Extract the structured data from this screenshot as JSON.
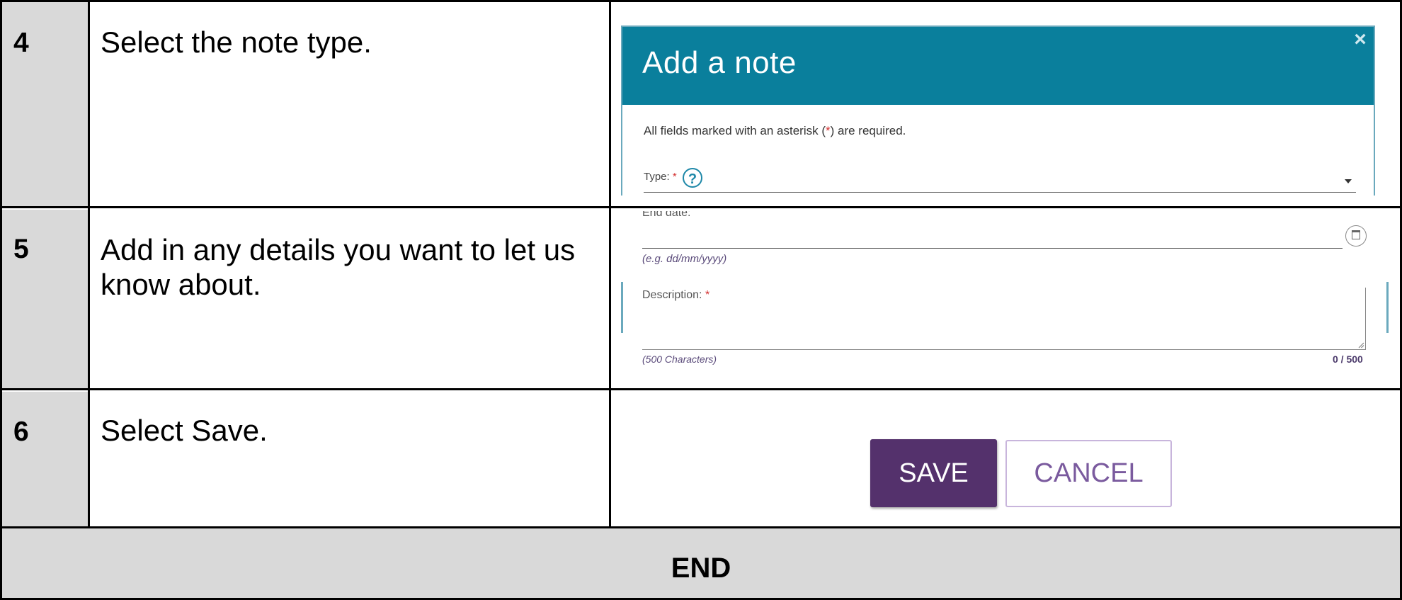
{
  "rows": [
    {
      "number": "4",
      "instruction": "Select the note type."
    },
    {
      "number": "5",
      "instruction": "Add in any details you want to let us know about."
    },
    {
      "number": "6",
      "instruction": "Select Save."
    }
  ],
  "end_label": "END",
  "add_note_dialog": {
    "title": "Add a note",
    "close_glyph": "×",
    "required_note_pre": "All fields marked with an asterisk (",
    "required_note_asterisk": "*",
    "required_note_post": ") are required.",
    "type_label": "Type:",
    "required_marker": "*",
    "help_glyph": "?"
  },
  "details_form": {
    "end_date_label": "End date:",
    "end_date_hint": "(e.g. dd/mm/yyyy)",
    "description_label": "Description:",
    "required_marker": "*",
    "description_hint": "(500 Characters)",
    "char_count": "0 / 500"
  },
  "buttons": {
    "save_label": "SAVE",
    "cancel_label": "CANCEL"
  },
  "colors": {
    "header_teal": "#0a7f9c",
    "save_purple": "#54316c",
    "cancel_text": "#7a5a9e",
    "number_cell_gray": "#d9d9d9",
    "required_red": "#d32f2f"
  }
}
